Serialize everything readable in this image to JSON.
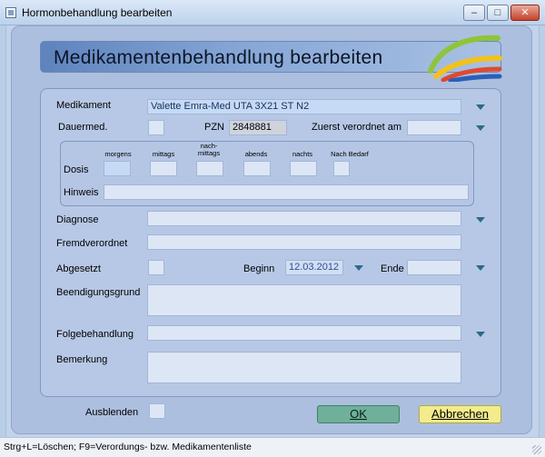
{
  "window": {
    "title": "Hormonbehandlung bearbeiten",
    "minimize": "–",
    "maximize": "□",
    "close": "✕"
  },
  "header": {
    "title": "Medikamentenbehandlung bearbeiten"
  },
  "form": {
    "medikament": {
      "label": "Medikament",
      "value": "Valette Emra-Med UTA 3X21 ST N2"
    },
    "dauermed": {
      "label": "Dauermed."
    },
    "pzn": {
      "label": "PZN",
      "value": "2848881"
    },
    "zuerst": {
      "label": "Zuerst verordnet am",
      "value": ""
    },
    "dosis": {
      "label": "Dosis",
      "columns": [
        "morgens",
        "mittags",
        "nach-\nmittags",
        "abends",
        "nachts",
        "Nach Bedarf"
      ]
    },
    "hinweis": {
      "label": "Hinweis",
      "value": ""
    },
    "diagnose": {
      "label": "Diagnose",
      "value": ""
    },
    "fremdverordnet": {
      "label": "Fremdverordnet",
      "value": ""
    },
    "abgesetzt": {
      "label": "Abgesetzt"
    },
    "beginn": {
      "label": "Beginn",
      "value": "12.03.2012"
    },
    "ende": {
      "label": "Ende",
      "value": ""
    },
    "beendigungsgrund": {
      "label": "Beendigungsgrund",
      "value": ""
    },
    "folgebehandlung": {
      "label": "Folgebehandlung",
      "value": ""
    },
    "bemerkung": {
      "label": "Bemerkung",
      "value": ""
    },
    "ausblenden": {
      "label": "Ausblenden"
    }
  },
  "buttons": {
    "ok": "OK",
    "cancel": "Abbrechen"
  },
  "status": {
    "text": "Strg+L=Löschen; F9=Verordungs- bzw. Medikamentenliste"
  },
  "colors": {
    "ok_button": "#6fb09a",
    "cancel_button": "#f2ec8c",
    "header_start": "#5e83bd",
    "accent": "#2b6a8a"
  }
}
